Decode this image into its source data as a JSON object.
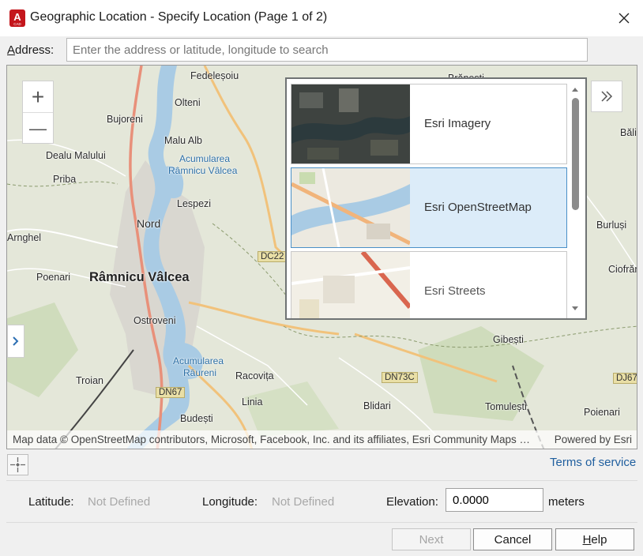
{
  "window": {
    "title": "Geographic Location - Specify Location (Page 1 of 2)",
    "app_icon_text": "A",
    "app_icon_sub": "CAD",
    "close_glyph": "✕",
    "colors": {
      "app_icon": "#c4161c",
      "selection": "#dcecf9",
      "link": "#1f5e9e"
    }
  },
  "address": {
    "label_mnemonic": "A",
    "label_rest": "ddress:",
    "placeholder": "Enter the address or latitude, longitude to search",
    "value": ""
  },
  "map": {
    "zoom_in_glyph": "+",
    "zoom_out_glyph": "—",
    "toggle_glyph": "»",
    "expand_glyph": "›",
    "labels": {
      "fedelesoiu": "Fedeleșoiu",
      "olteni": "Olteni",
      "bujoreni": "Bujoreni",
      "malu_alb": "Malu Alb",
      "dealu_malului": "Dealu Malului",
      "acumularea_rv_1": "Acumularea",
      "acumularea_rv_2": "Râmnicu Vâlcea",
      "priba": "Priba",
      "lespezi": "Lespezi",
      "nord": "Nord",
      "arnghel": "Arnghel",
      "dc22": "DC22",
      "poenari_w": "Poenari",
      "ramnicu_valcea": "Râmnicu Vâlcea",
      "ostroveni": "Ostroveni",
      "acumularea_raureni_1": "Acumularea",
      "acumularea_raureni_2": "Râureni",
      "racovita": "Racovița",
      "troian": "Troian",
      "dn67": "DN67",
      "linia": "Linia",
      "budesti": "Budești",
      "bali": "Băli",
      "burlusi": "Burluși",
      "ciofrang": "Ciofrăn",
      "gibesti": "Gibești",
      "dn73c": "DN73C",
      "bildari": "Blidari",
      "tomulesti": "Tomulești",
      "dj67": "DJ67",
      "poienari_e": "Poienari",
      "branesti": "Brănești"
    },
    "attribution": "Map data © OpenStreetMap contributors, Microsoft, Facebook, Inc. and its affiliates, Esri Community Maps contributors",
    "powered_by": "Powered by Esri"
  },
  "gallery": {
    "items": [
      {
        "label": "Esri Imagery",
        "selected": false
      },
      {
        "label": "Esri OpenStreetMap",
        "selected": true
      },
      {
        "label": "Esri Streets",
        "selected": false
      }
    ]
  },
  "footer": {
    "terms": "Terms of service",
    "latitude_label": "Latitude:",
    "latitude_value": "Not Defined",
    "longitude_label": "Longitude:",
    "longitude_value": "Not Defined",
    "elevation_label": "Elevation:",
    "elevation_value": "0.0000",
    "elevation_unit": "meters"
  },
  "buttons": {
    "next": "Next",
    "cancel": "Cancel",
    "help_mnemonic": "H",
    "help_rest": "elp"
  }
}
